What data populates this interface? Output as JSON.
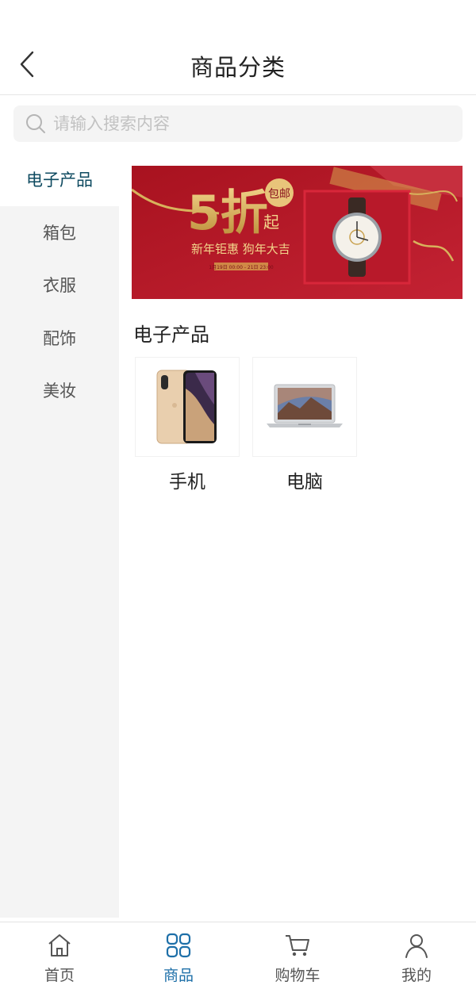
{
  "header": {
    "title": "商品分类",
    "back_icon": "chevron-left-icon"
  },
  "search": {
    "placeholder": "请输入搜索内容",
    "value": "",
    "icon": "search-icon"
  },
  "sidebar": {
    "items": [
      {
        "label": "电子产品",
        "active": true
      },
      {
        "label": "箱包",
        "active": false
      },
      {
        "label": "衣服",
        "active": false
      },
      {
        "label": "配饰",
        "active": false
      },
      {
        "label": "美妆",
        "active": false
      }
    ]
  },
  "banner": {
    "big_text": "5折",
    "qi": "起",
    "badge": "包邮",
    "slogan": "新年钜惠 狗年大吉",
    "date": "1月19日 00:00 - 21日 23:00"
  },
  "section": {
    "title": "电子产品"
  },
  "products": [
    {
      "name": "手机",
      "icon": "phone-image"
    },
    {
      "name": "电脑",
      "icon": "laptop-image"
    }
  ],
  "tabbar": {
    "items": [
      {
        "label": "首页",
        "icon": "home-icon",
        "active": false
      },
      {
        "label": "商品",
        "icon": "grid-icon",
        "active": true
      },
      {
        "label": "购物车",
        "icon": "cart-icon",
        "active": false
      },
      {
        "label": "我的",
        "icon": "user-icon",
        "active": false
      }
    ]
  },
  "colors": {
    "accent": "#1d6fa8",
    "sidebar_active": "#0e4a60",
    "banner_red": "#b3182a",
    "gold": "#d8b25c"
  }
}
